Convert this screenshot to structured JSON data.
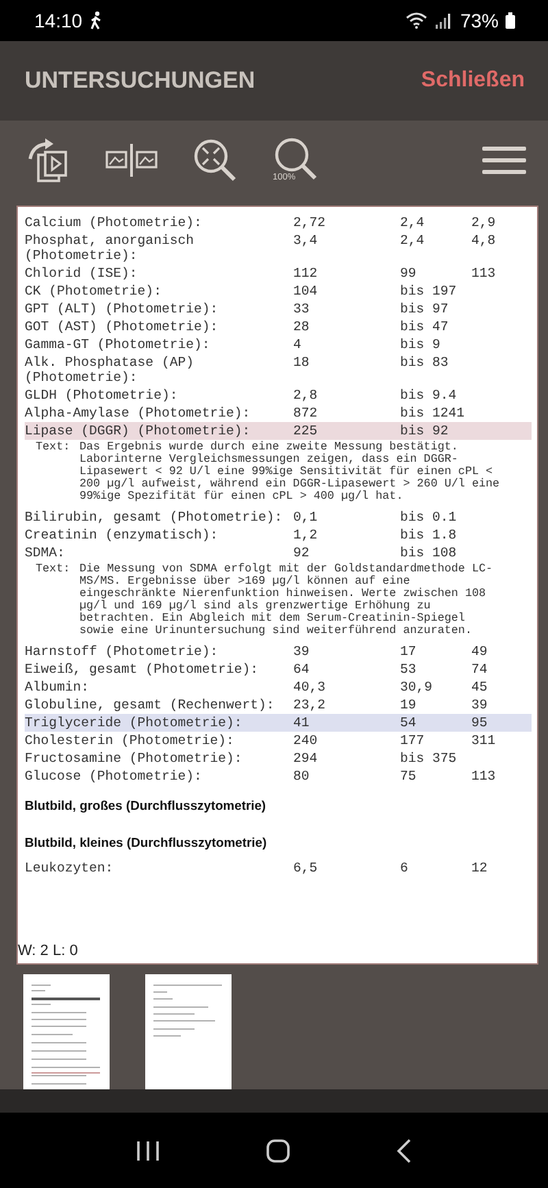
{
  "status_bar": {
    "time": "14:10",
    "battery": "73%"
  },
  "header": {
    "title": "UNTERSUCHUNGEN",
    "close_label": "Schließen"
  },
  "toolbar": {
    "zoom_label": "100%"
  },
  "document": {
    "rows": [
      {
        "kind": "result",
        "name": "Calcium (Photometrie):",
        "value": "2,72",
        "ref_low": "2,4",
        "ref_high": "2,9"
      },
      {
        "kind": "result",
        "name": "Phosphat, anorganisch (Photometrie):",
        "value": "3,4",
        "ref_low": "2,4",
        "ref_high": "4,8"
      },
      {
        "kind": "result",
        "name": "Chlorid (ISE):",
        "value": "112",
        "ref_low": "99",
        "ref_high": "113"
      },
      {
        "kind": "result",
        "name": "CK (Photometrie):",
        "value": "104",
        "ref_low": "bis 197"
      },
      {
        "kind": "result",
        "name": "GPT (ALT) (Photometrie):",
        "value": "33",
        "ref_low": "bis 97"
      },
      {
        "kind": "result",
        "name": "GOT (AST) (Photometrie):",
        "value": "28",
        "ref_low": "bis 47"
      },
      {
        "kind": "result",
        "name": "Gamma-GT (Photometrie):",
        "value": "4",
        "ref_low": "bis 9"
      },
      {
        "kind": "result",
        "name": "Alk. Phosphatase (AP) (Photometrie):",
        "value": "18",
        "ref_low": "bis 83"
      },
      {
        "kind": "result",
        "name": "GLDH (Photometrie):",
        "value": "2,8",
        "ref_low": "bis 9.4"
      },
      {
        "kind": "result",
        "name": "Alpha-Amylase (Photometrie):",
        "value": "872",
        "ref_low": "bis 1241"
      },
      {
        "kind": "result",
        "name": "Lipase (DGGR) (Photometrie):",
        "value": "225",
        "ref_low": "bis 92",
        "color": "#ecdadd"
      },
      {
        "kind": "note",
        "label": "Text:",
        "text": "Das Ergebnis wurde durch eine zweite Messung bestätigt. Laborinterne Vergleichsmessungen zeigen, dass ein DGGR-Lipasewert < 92 U/l eine 99%ige Sensitivität für einen cPL < 200 µg/l aufweist, während ein DGGR-Lipasewert > 260 U/l eine 99%ige Spezifität für einen cPL > 400 µg/l hat."
      },
      {
        "kind": "result",
        "name": "Bilirubin, gesamt (Photometrie):",
        "value": "0,1",
        "ref_low": "bis 0.1"
      },
      {
        "kind": "result",
        "name": "Creatinin (enzymatisch):",
        "value": "1,2",
        "ref_low": "bis 1.8"
      },
      {
        "kind": "result",
        "name": "SDMA:",
        "value": "92",
        "ref_low": "bis 108"
      },
      {
        "kind": "note",
        "label": "Text:",
        "text": "Die Messung von SDMA erfolgt mit der Goldstandardmethode LC-MS/MS. Ergebnisse über >169 µg/l können auf eine eingeschränkte Nierenfunktion hinweisen. Werte zwischen 108 µg/l und 169 µg/l sind als grenzwertige Erhöhung zu betrachten. Ein Abgleich mit dem Serum-Creatinin-Spiegel sowie eine Urinuntersuchung sind weiterführend anzuraten."
      },
      {
        "kind": "result",
        "name": "Harnstoff (Photometrie):",
        "value": "39",
        "ref_low": "17",
        "ref_high": "49"
      },
      {
        "kind": "result",
        "name": "Eiweiß, gesamt (Photometrie):",
        "value": "64",
        "ref_low": "53",
        "ref_high": "74"
      },
      {
        "kind": "result",
        "name": "Albumin:",
        "value": "40,3",
        "ref_low": "30,9",
        "ref_high": "45"
      },
      {
        "kind": "result",
        "name": "Globuline, gesamt (Rechenwert):",
        "value": "23,2",
        "ref_low": "19",
        "ref_high": "39"
      },
      {
        "kind": "result",
        "name": "Triglyceride (Photometrie):",
        "value": "41",
        "ref_low": "54",
        "ref_high": "95",
        "color": "#dde0f0"
      },
      {
        "kind": "result",
        "name": "Cholesterin (Photometrie):",
        "value": "240",
        "ref_low": "177",
        "ref_high": "311"
      },
      {
        "kind": "result",
        "name": "Fructosamine (Photometrie):",
        "value": "294",
        "ref_low": "bis 375"
      },
      {
        "kind": "result",
        "name": "Glucose (Photometrie):",
        "value": "80",
        "ref_low": "75",
        "ref_high": "113"
      },
      {
        "kind": "heading",
        "text": "Blutbild, großes (Durchflusszytometrie)"
      },
      {
        "kind": "heading",
        "text": "Blutbild, kleines (Durchflusszytometrie)"
      },
      {
        "kind": "result",
        "name": "Leukozyten:",
        "value": "6,5",
        "ref_low": "6",
        "ref_high": "12"
      }
    ],
    "overlay_label": "W: 2 L: 0"
  }
}
